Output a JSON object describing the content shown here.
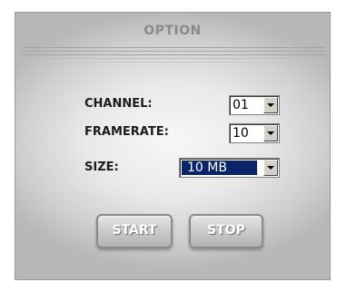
{
  "panel": {
    "title": "OPTION"
  },
  "fields": {
    "channel": {
      "label": "CHANNEL:",
      "value": "01"
    },
    "framerate": {
      "label": "FRAMERATE:",
      "value": "10"
    },
    "size": {
      "label": "SIZE:",
      "value": "10 MB"
    }
  },
  "buttons": {
    "start": "START",
    "stop": "STOP"
  },
  "colors": {
    "selection": "#0a246a",
    "panel": "#e6e6e6"
  },
  "icons": {
    "dropdown": "chevron-down-icon"
  }
}
